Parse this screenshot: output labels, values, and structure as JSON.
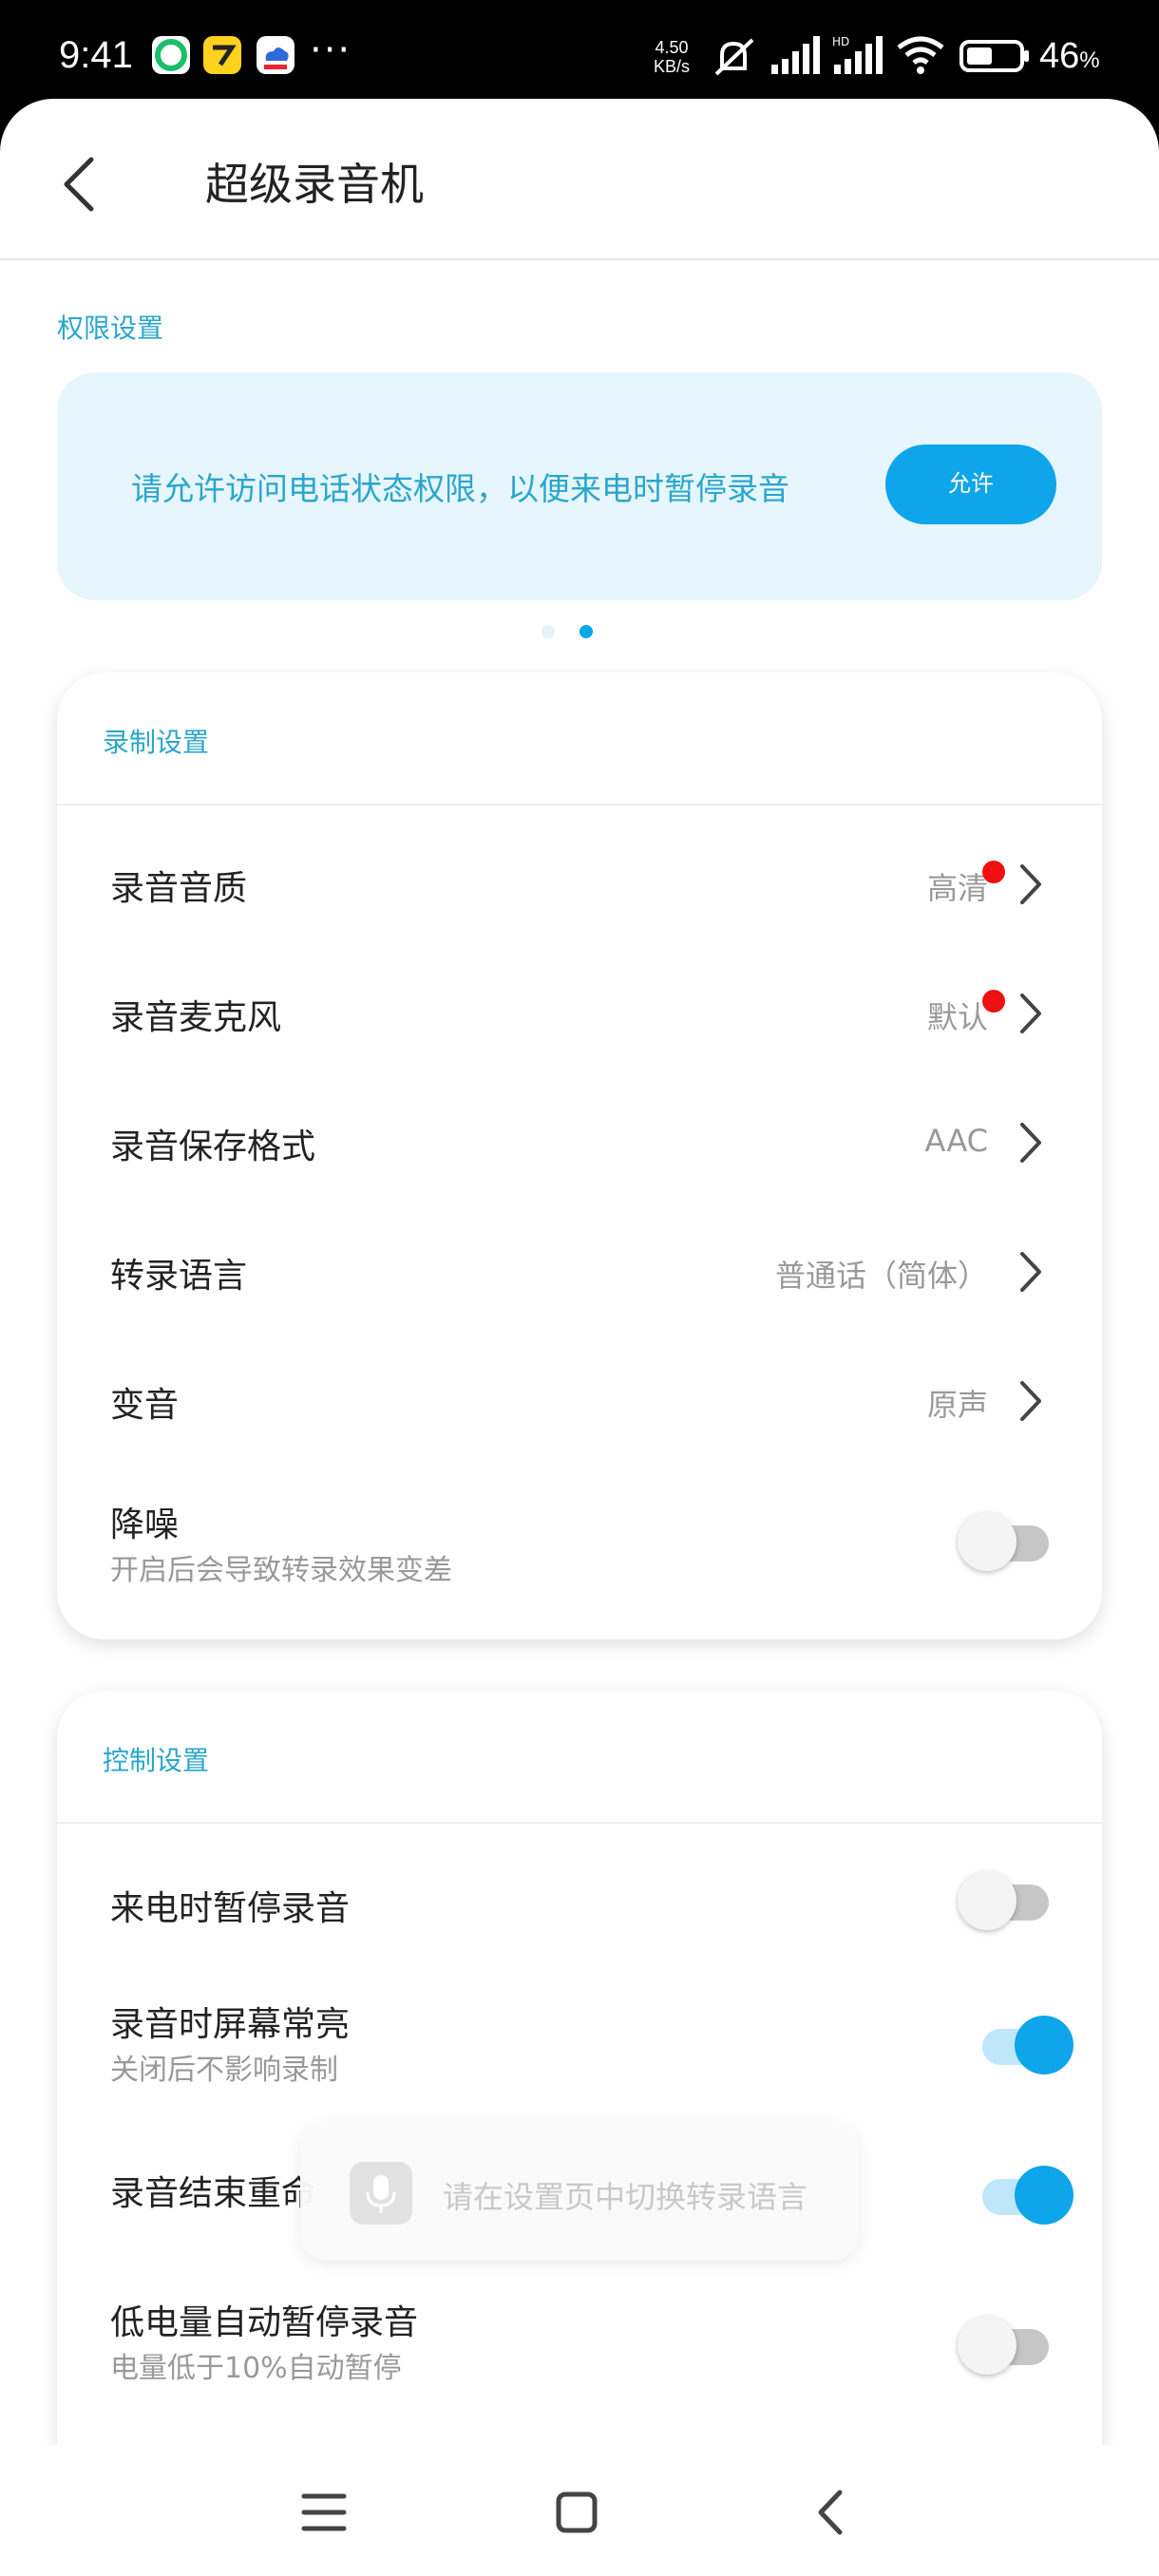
{
  "status_bar": {
    "time": "9:41",
    "more": "···",
    "speed_value": "4.50",
    "speed_unit": "KB/s",
    "battery_percent": "46",
    "battery_unit": "%",
    "icons": [
      "app-icon-green",
      "app-icon-yellow",
      "app-icon-cloud",
      "mute-icon",
      "signal-icon",
      "signal-hd-icon",
      "wifi-icon",
      "battery-icon"
    ]
  },
  "header": {
    "title": "超级录音机",
    "back_icon": "chevron-left-icon"
  },
  "permissions": {
    "section_label": "权限设置",
    "banner_text": "请允许访问电话状态权限，以便来电时暂停录音",
    "button_label": "允许",
    "accent_color": "#0ea5ea"
  },
  "pager": {
    "count": 2,
    "active_index": 1
  },
  "record_settings": {
    "section_label": "录制设置",
    "items": [
      {
        "title": "录音音质",
        "value": "高清",
        "badge": true
      },
      {
        "title": "录音麦克风",
        "value": "默认",
        "badge": true
      },
      {
        "title": "录音保存格式",
        "value": "AAC"
      },
      {
        "title": "转录语言",
        "value": "普通话（简体）"
      },
      {
        "title": "变音",
        "value": "原声"
      }
    ],
    "noise_reduction": {
      "title": "降噪",
      "subtitle": "开启后会导致转录效果变差",
      "on": false
    }
  },
  "control_settings": {
    "section_label": "控制设置",
    "items": [
      {
        "title": "来电时暂停录音",
        "subtitle": "",
        "on": false
      },
      {
        "title": "录音时屏幕常亮",
        "subtitle": "关闭后不影响录制",
        "on": true
      },
      {
        "title": "录音结束重命",
        "subtitle": "",
        "on": true
      },
      {
        "title": "低电量自动暂停录音",
        "subtitle": "电量低于10%自动暂停",
        "on": false
      }
    ]
  },
  "toast": {
    "text": "请在设置页中切换转录语言",
    "icon": "microphone-icon"
  },
  "nav_bar": {
    "icons": [
      "menu-icon",
      "home-square-icon",
      "back-triangle-icon"
    ]
  }
}
